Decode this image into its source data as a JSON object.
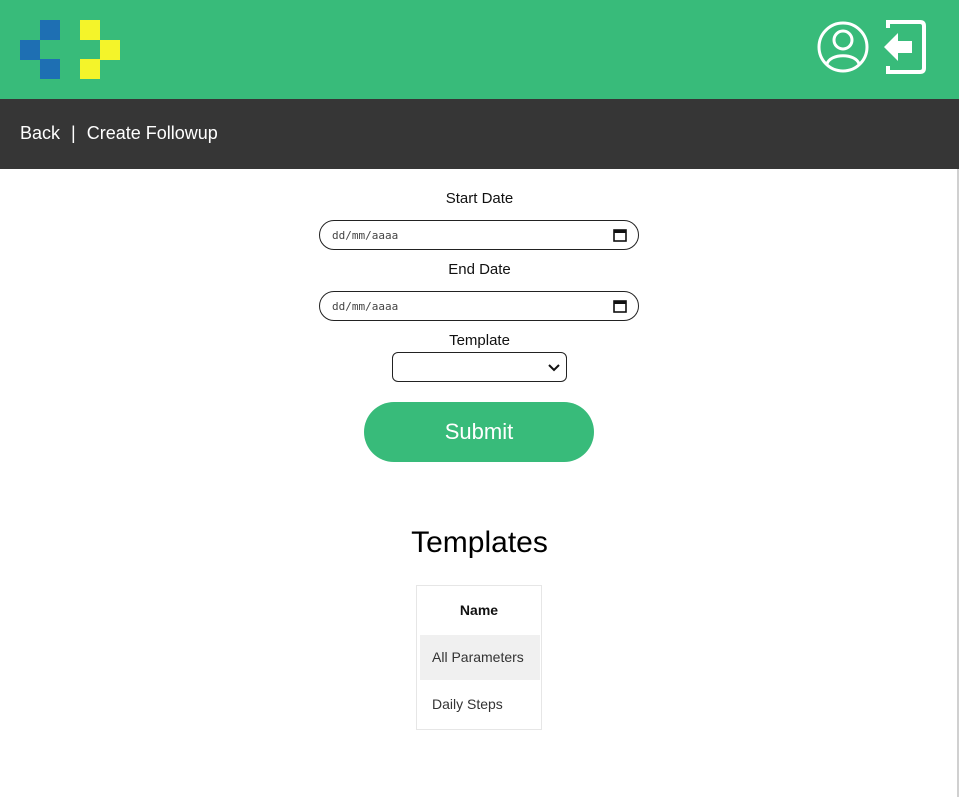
{
  "header": {
    "logo_icon": "clinic-cross-logo",
    "colors": {
      "brand_green": "#38bb7a",
      "logo_blue": "#1e6fb3",
      "logo_yellow": "#f4f42a",
      "subbar_bg": "#363636"
    },
    "user_icon": "user-profile-icon",
    "logout_icon": "logout-icon"
  },
  "subbar": {
    "back_label": "Back",
    "separator": "|",
    "page_title": "Create Followup"
  },
  "form": {
    "start_date_label": "Start Date",
    "start_date_placeholder": "dd/mm/aaaa",
    "end_date_label": "End Date",
    "end_date_placeholder": "dd/mm/aaaa",
    "template_label": "Template",
    "template_selected": "",
    "submit_label": "Submit"
  },
  "templates": {
    "title": "Templates",
    "column_header": "Name",
    "rows": [
      "All Parameters",
      "Daily Steps"
    ]
  }
}
